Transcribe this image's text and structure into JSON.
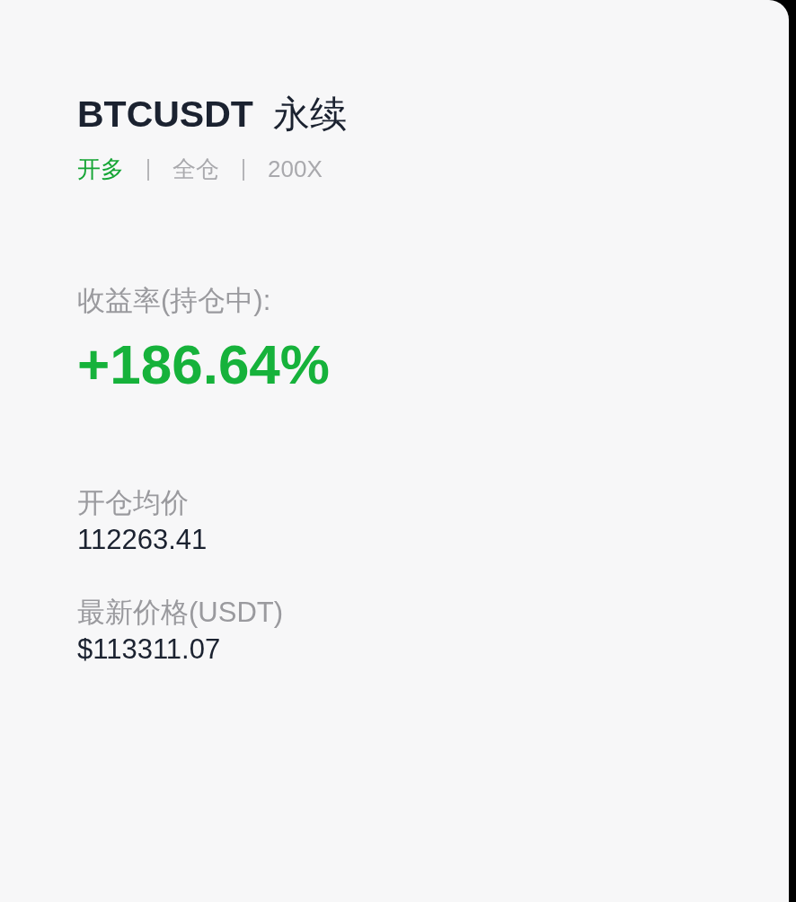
{
  "title": {
    "symbol": "BTCUSDT",
    "contract": "永续"
  },
  "tags": [
    {
      "label": "开多",
      "color": "#16a535"
    },
    {
      "label": "全仓",
      "color": "#a9a9ad"
    },
    {
      "label": "200X",
      "color": "#a9a9ad"
    }
  ],
  "return": {
    "label": "收益率(持仓中):",
    "value": "+186.64%"
  },
  "fields": [
    {
      "label": "开仓均价",
      "value": "112263.41"
    },
    {
      "label": "最新价格(USDT)",
      "value": "$113311.07"
    }
  ]
}
